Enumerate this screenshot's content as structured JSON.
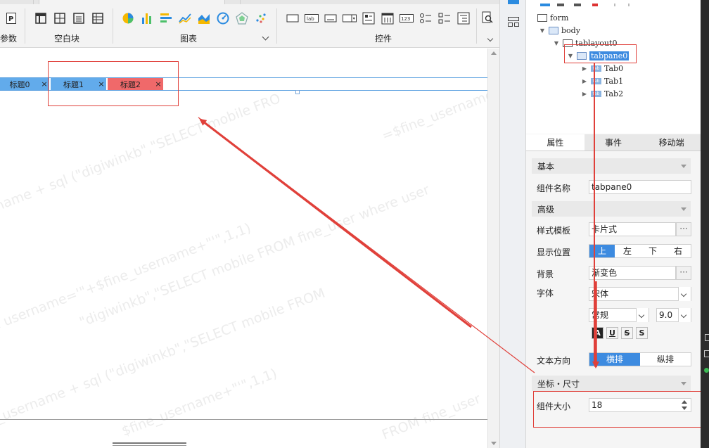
{
  "ribbon": {
    "param_label": "参数",
    "blank_block_label": "空白块",
    "chart_label": "图表",
    "widget_label": "控件"
  },
  "canvas": {
    "tabs": [
      "标题0",
      "标题1",
      "标题2"
    ],
    "close_glyph": "×",
    "watermarks": [
      "name + sql (\"digiwinkb\",\"SELECT mobile FRO",
      "=$fine_username",
      "e username='\"+$fine_username+\"'\",1,1)",
      "\"digiwinkb\",\"SELECT mobile FROM fine_user where user",
      "e_username + sql (\"digiwinkb\",\"SELECT mobile FROM",
      "$fine_username+\"'\",1,1)",
      "FROM fine_user"
    ]
  },
  "tree": {
    "form": "form",
    "body": "body",
    "tablayout": "tablayout0",
    "tabpane": "tabpane0",
    "tab_icon": "tab",
    "tabs": [
      "Tab0",
      "Tab1",
      "Tab2"
    ]
  },
  "props": {
    "tabs": [
      "属性",
      "事件",
      "移动端"
    ],
    "basic": "基本",
    "name_label": "组件名称",
    "name_value": "tabpane0",
    "advanced": "高级",
    "style_label": "样式模板",
    "style_value": "卡片式",
    "pos_label": "显示位置",
    "pos_options": [
      "上",
      "左",
      "下",
      "右"
    ],
    "bg_label": "背景",
    "bg_value": "渐变色",
    "font_label": "字体",
    "font_value": "宋体",
    "font_style": "常规",
    "font_size": "9.0",
    "format_buttons": [
      "A",
      "U",
      "S",
      "S"
    ],
    "textdir_label": "文本方向",
    "textdir_options": [
      "横排",
      "纵排"
    ],
    "coord_section": "坐标・尺寸",
    "size_label": "组件大小",
    "size_value": "18",
    "more_glyph": "···"
  },
  "colors": {
    "tab_blue": "#62abeb",
    "tab_selected": "#f0696a",
    "accent": "#3d8be0",
    "annotation_red": "#e0403a"
  }
}
